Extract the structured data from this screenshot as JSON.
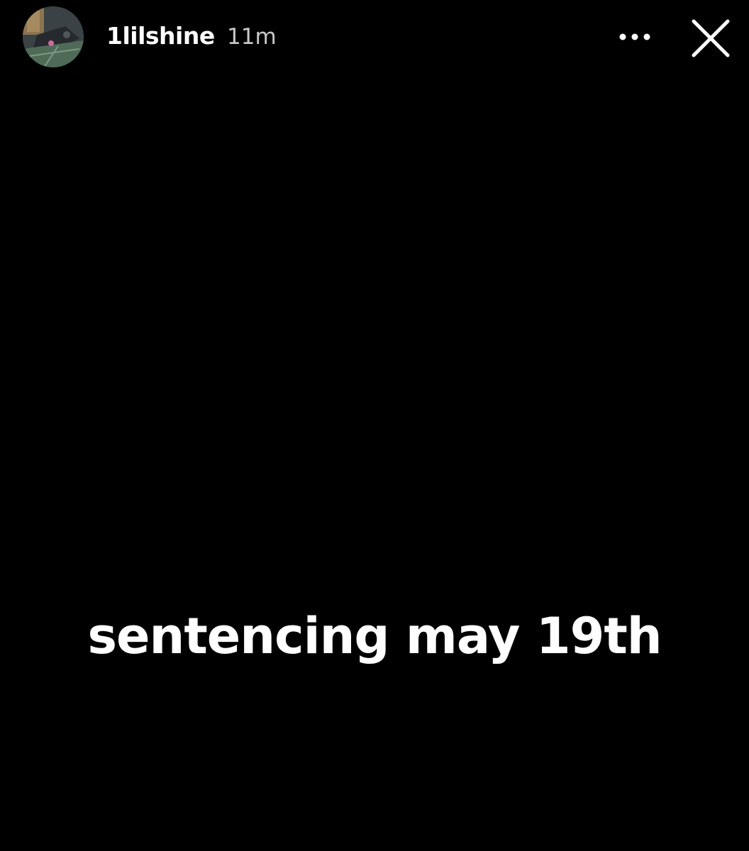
{
  "story": {
    "username": "1lilshine",
    "time_ago": "11m",
    "avatar_icon": "profile-avatar",
    "more_icon": "more-options-icon",
    "close_icon": "close-icon",
    "caption": "sentencing may 19th"
  },
  "colors": {
    "background": "#000000",
    "text_primary": "#ffffff",
    "text_secondary": "#c9c9c9"
  }
}
